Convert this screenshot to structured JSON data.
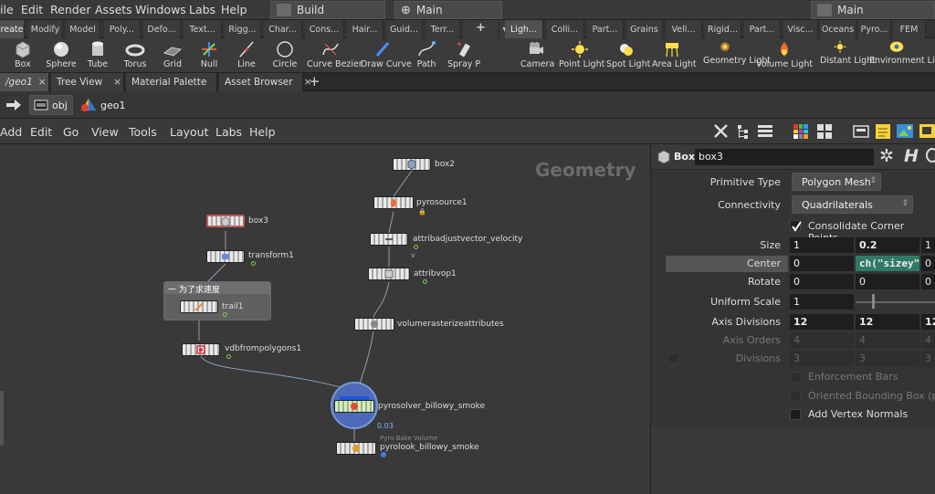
{
  "menubar": {
    "items": [
      "ile",
      "Edit",
      "Render",
      "Assets",
      "Windows",
      "Labs",
      "Help"
    ],
    "desktop1": "Build",
    "desktop2": "Main",
    "desktop3": "Main"
  },
  "shelf_tabs": [
    "reate",
    "Modify",
    "Model",
    "Poly...",
    "Defo...",
    "Text...",
    "Rigg...",
    "Char...",
    "Cons...",
    "Hair...",
    "Guid...",
    "Terr...",
    "+",
    "Ligh...",
    "Colli...",
    "Part...",
    "Grains",
    "Vell...",
    "Rigid...",
    "Part...",
    "Visc...",
    "Oceans",
    "Pyro...",
    "FEM"
  ],
  "shelf_tools": {
    "left": [
      {
        "label": "Box",
        "icon": "box-icon"
      },
      {
        "label": "Sphere",
        "icon": "sphere-icon"
      },
      {
        "label": "Tube",
        "icon": "tube-icon"
      },
      {
        "label": "Torus",
        "icon": "torus-icon"
      },
      {
        "label": "Grid",
        "icon": "grid-icon"
      },
      {
        "label": "Null",
        "icon": "null-icon"
      },
      {
        "label": "Line",
        "icon": "line-icon"
      },
      {
        "label": "Circle",
        "icon": "circle-icon"
      },
      {
        "label": "Curve Bezier",
        "icon": "curve-bezier-icon"
      },
      {
        "label": "Draw Curve",
        "icon": "draw-curve-icon"
      },
      {
        "label": "Path",
        "icon": "path-icon"
      },
      {
        "label": "Spray P",
        "icon": "spray-paint-icon"
      }
    ],
    "right": [
      {
        "label": "Camera",
        "icon": "camera-icon"
      },
      {
        "label": "Point Light",
        "icon": "point-light-icon"
      },
      {
        "label": "Spot Light",
        "icon": "spot-light-icon"
      },
      {
        "label": "Area Light",
        "icon": "area-light-icon"
      },
      {
        "label": "Geometry Light",
        "icon": "geometry-light-icon"
      },
      {
        "label": "Volume Light",
        "icon": "volume-light-icon"
      },
      {
        "label": "Distant Light",
        "icon": "distant-light-icon"
      },
      {
        "label": "Environment Light",
        "icon": "environment-light-icon"
      }
    ]
  },
  "pane_tabs": [
    {
      "label": "/geo1",
      "active": true
    },
    {
      "label": "Tree View"
    },
    {
      "label": "Material Palette"
    },
    {
      "label": "Asset Browser"
    }
  ],
  "pathbar": {
    "obj": "obj",
    "geo": "geo1"
  },
  "network_menu": [
    "Add",
    "Edit",
    "Go",
    "View",
    "Tools",
    "Layout",
    "Labs",
    "Help"
  ],
  "network": {
    "context_label": "Geometry",
    "netbox_title": "一 为了求速度",
    "nodes": {
      "box3": "box3",
      "transform1": "transform1",
      "trail1": "trail1",
      "vdbfrompolygons1": "vdbfrompolygons1",
      "box2": "box2",
      "pyrosource1": "pyrosource1",
      "attribadjustvector_velocity": "attribadjustvector_velocity",
      "attribvop1": "attribvop1",
      "volumerasterizeattributes": "volumerasterizeattributes",
      "pyrosolver_billowy_smoke": "pyrosolver_billowy_smoke",
      "pyrosolver_info": "0.03",
      "pyrolook_billowy_smoke": "pyrolook_billowy_smoke",
      "pyrolook_comment": "Pyro Bake Volume"
    }
  },
  "params": {
    "node_type": "Box",
    "node_name": "box3",
    "primitive_type": {
      "label": "Primitive Type",
      "value": "Polygon Mesh"
    },
    "connectivity": {
      "label": "Connectivity",
      "value": "Quadrilaterals"
    },
    "consolidate": "Consolidate Corner Points",
    "size": {
      "label": "Size",
      "v": [
        "1",
        "0.2",
        "1"
      ]
    },
    "center": {
      "label": "Center",
      "v": [
        "0",
        "ch(\"sizey\"",
        "0"
      ]
    },
    "rotate": {
      "label": "Rotate",
      "v": [
        "0",
        "0",
        "0"
      ]
    },
    "uniform_scale": {
      "label": "Uniform Scale",
      "v": "1"
    },
    "axis_divisions": {
      "label": "Axis Divisions",
      "v": [
        "12",
        "12",
        "12"
      ]
    },
    "axis_orders": {
      "label": "Axis Orders",
      "v": [
        "4",
        "4",
        "4"
      ]
    },
    "divisions": {
      "label": "Divisions",
      "v": [
        "3",
        "3",
        "3"
      ]
    },
    "enforcement_bars": "Enforcement Bars",
    "oriented_bbox": "Oriented Bounding Box (poin",
    "add_vertex_normals": "Add Vertex Normals"
  }
}
